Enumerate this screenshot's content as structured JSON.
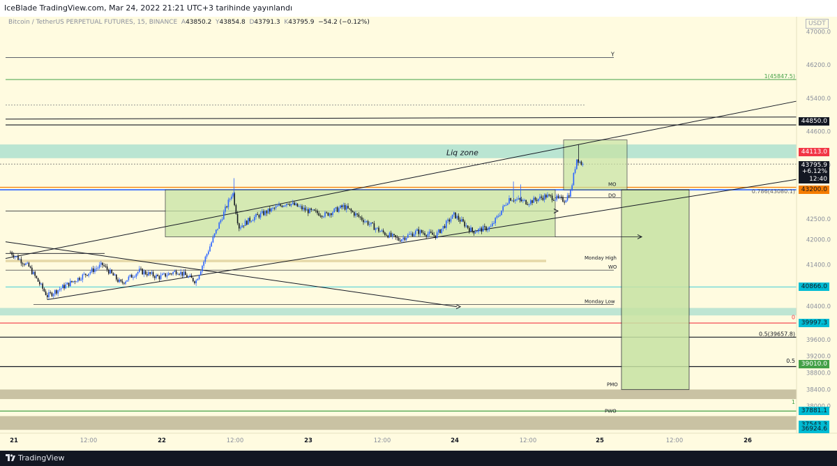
{
  "header": {
    "publish_text": "IceBlade TradingView.com, Mar 24, 2022 21:21 UTC+3 tarihinde yayınlandı"
  },
  "legend": {
    "symbol": "Bitcoin / TetherUS PERPETUAL FUTURES, 15, BINANCE",
    "o_label": "A",
    "o": "43850.2",
    "h_label": "Y",
    "h": "43854.8",
    "l_label": "D",
    "l": "43791.3",
    "c_label": "K",
    "c": "43795.9",
    "change": "−54.2 (−0.12%)"
  },
  "currency_badge": "USDT",
  "colors": {
    "background": "#fffbe0",
    "up_candle": "#2962ff",
    "down_candle": "#131722",
    "box_fill": "#c7e3a4",
    "liq_zone_fill": "#aee0cf",
    "gray_zone": "#c9c2a3"
  },
  "chart_data": {
    "type": "candlestick",
    "symbol": "BTCUSDT.P",
    "timeframe": "15",
    "ylim": [
      36930,
      47360
    ],
    "y_ticks": [
      "47000.0",
      "46200.0",
      "45400.0",
      "44600.0",
      "43800.0",
      "42500.0",
      "42000.0",
      "41400.0",
      "40400.0",
      "39600.0",
      "39200.0",
      "38800.0",
      "38400.0",
      "38000.0"
    ],
    "x_ticks": [
      "21",
      "12:00",
      "22",
      "12:00",
      "23",
      "12:00",
      "24",
      "12:00",
      "25",
      "12:00",
      "26"
    ],
    "approx_close_path": [
      {
        "x": "21 00:00",
        "close": 41700
      },
      {
        "x": "21 03:00",
        "close": 41350
      },
      {
        "x": "21 06:00",
        "close": 40650
      },
      {
        "x": "21 09:00",
        "close": 40900
      },
      {
        "x": "21 12:00",
        "close": 41150
      },
      {
        "x": "21 15:00",
        "close": 41400
      },
      {
        "x": "21 18:00",
        "close": 40950
      },
      {
        "x": "21 21:00",
        "close": 41250
      },
      {
        "x": "22 00:00",
        "close": 41100
      },
      {
        "x": "22 03:00",
        "close": 41250
      },
      {
        "x": "22 06:00",
        "close": 41000
      },
      {
        "x": "22 09:00",
        "close": 42100
      },
      {
        "x": "22 12:00",
        "close": 43150
      },
      {
        "x": "22 13:00",
        "close": 42300
      },
      {
        "x": "22 15:00",
        "close": 42500
      },
      {
        "x": "22 18:00",
        "close": 42700
      },
      {
        "x": "22 21:00",
        "close": 42900
      },
      {
        "x": "23 00:00",
        "close": 42700
      },
      {
        "x": "23 03:00",
        "close": 42600
      },
      {
        "x": "23 06:00",
        "close": 42800
      },
      {
        "x": "23 09:00",
        "close": 42500
      },
      {
        "x": "23 12:00",
        "close": 42200
      },
      {
        "x": "23 15:00",
        "close": 42000
      },
      {
        "x": "23 18:00",
        "close": 42200
      },
      {
        "x": "23 21:00",
        "close": 42100
      },
      {
        "x": "24 00:00",
        "close": 42600
      },
      {
        "x": "24 03:00",
        "close": 42200
      },
      {
        "x": "24 06:00",
        "close": 42300
      },
      {
        "x": "24 09:00",
        "close": 43000
      },
      {
        "x": "24 12:00",
        "close": 42900
      },
      {
        "x": "24 15:00",
        "close": 43050
      },
      {
        "x": "24 18:00",
        "close": 42950
      },
      {
        "x": "24 19:00",
        "close": 43150
      },
      {
        "x": "24 20:00",
        "close": 43950
      },
      {
        "x": "24 21:00",
        "close": 43800
      }
    ],
    "price_labels": [
      {
        "value": "44850.0",
        "price": 44850,
        "color": "#131722",
        "text_color": "#ffffff"
      },
      {
        "value": "44113.0",
        "price": 44113,
        "color": "#f23645",
        "text_color": "#ffffff"
      },
      {
        "value": "43795.9",
        "price": 43795.9,
        "color": "#131722",
        "text_color": "#ffffff"
      },
      {
        "value": "+6.12%",
        "price": 43630,
        "color": "#131722",
        "text_color": "#ffffff"
      },
      {
        "value": "12:40",
        "price": 43460,
        "color": "#131722",
        "text_color": "#ffffff"
      },
      {
        "value": "43200.0",
        "price": 43200,
        "color": "#f57c00",
        "text_color": "#131722"
      },
      {
        "value": "40866.0",
        "price": 40866,
        "color": "#00bcd4",
        "text_color": "#131722"
      },
      {
        "value": "39997.3",
        "price": 39997.3,
        "color": "#00bcd4",
        "text_color": "#131722"
      },
      {
        "value": "39010.0",
        "price": 39010,
        "color": "#43a047",
        "text_color": "#ffffff"
      },
      {
        "value": "37881.1",
        "price": 37881.1,
        "color": "#00bcd4",
        "text_color": "#131722"
      },
      {
        "value": "37543.3",
        "price": 37543.3,
        "color": "#00bcd4",
        "text_color": "#131722"
      },
      {
        "value": "37152.6",
        "price": 37152.6,
        "color": "#9c27b0",
        "text_color": "#ffffff"
      },
      {
        "value": "36924.6",
        "price": 36924.6,
        "color": "#00bcd4",
        "text_color": "#131722"
      }
    ],
    "annotations": [
      {
        "text": "Y",
        "price": 46380
      },
      {
        "text": "1(45847.5)",
        "price": 45850
      },
      {
        "text": "Liq zone",
        "price": 44000
      },
      {
        "text": "MO",
        "price": 43260
      },
      {
        "text": "0.786(43080.1)",
        "price": 43080
      },
      {
        "text": "DO",
        "price": 42995
      },
      {
        "text": "Monday High",
        "price": 41490
      },
      {
        "text": "WO",
        "price": 41270
      },
      {
        "text": "Monday Low",
        "price": 40440
      },
      {
        "text": "0",
        "price": 40055
      },
      {
        "text": "0.5(39657.8)",
        "price": 39658
      },
      {
        "text": "0.5",
        "price": 39010
      },
      {
        "text": "PMO",
        "price": 38450
      },
      {
        "text": "1",
        "price": 38020
      },
      {
        "text": "PWO",
        "price": 37810
      }
    ]
  },
  "footer": {
    "brand": "TradingView"
  }
}
